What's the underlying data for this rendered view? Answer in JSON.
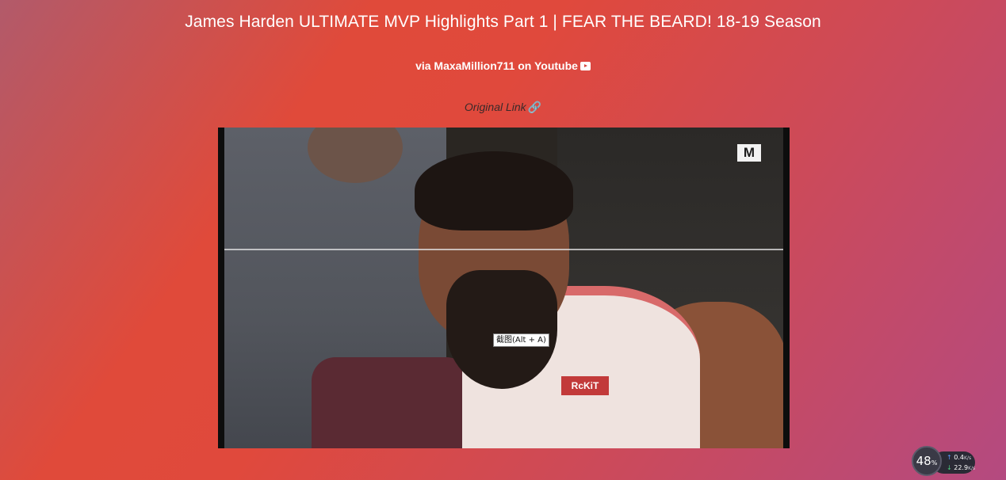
{
  "header": {
    "title": "James Harden ULTIMATE MVP Highlights Part 1 | FEAR THE BEARD! 18-19 Season",
    "via_text": "via MaxaMillion711 on Youtube",
    "via_icon": "youtube-icon",
    "original_link_label": "Original Link",
    "original_link_icon": "link-icon"
  },
  "video": {
    "channel_watermark": "M",
    "jersey_text": "RcKiT",
    "tooltip": "截图(Alt + A)"
  },
  "net_monitor": {
    "percent": "48",
    "percent_unit": "%",
    "upload_value": "0.4",
    "upload_unit": "K/s",
    "download_value": "22.9",
    "download_unit": "K/s"
  },
  "colors": {
    "background_start": "#b25a6a",
    "background_mid": "#e04a3a",
    "background_end": "#b44a80",
    "text": "#ffffff",
    "link_text": "#3a2a2a"
  }
}
